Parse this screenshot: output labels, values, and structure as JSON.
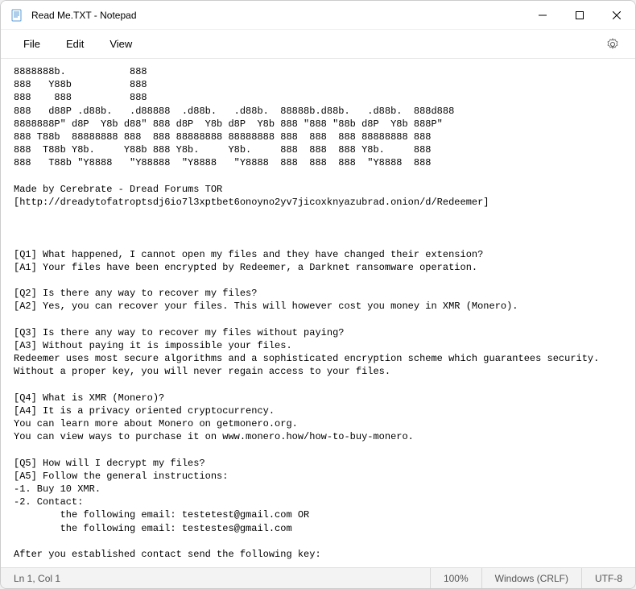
{
  "window": {
    "title": "Read Me.TXT - Notepad"
  },
  "menu": {
    "file": "File",
    "edit": "Edit",
    "view": "View"
  },
  "content": {
    "text": "8888888b.           888\n888   Y88b          888\n888    888          888\n888   d88P .d88b.   .d88888  .d88b.   .d88b.  88888b.d88b.   .d88b.  888d888\n8888888P\" d8P  Y8b d88\" 888 d8P  Y8b d8P  Y8b 888 \"888 \"88b d8P  Y8b 888P\"\n888 T88b  88888888 888  888 88888888 88888888 888  888  888 88888888 888\n888  T88b Y8b.     Y88b 888 Y8b.     Y8b.     888  888  888 Y8b.     888\n888   T88b \"Y8888   \"Y88888  \"Y8888   \"Y8888  888  888  888  \"Y8888  888\n\nMade by Cerebrate - Dread Forums TOR\n[http://dreadytofatroptsdj6io7l3xptbet6onoyno2yv7jicoxknyazubrad.onion/d/Redeemer]\n\n\n\n[Q1] What happened, I cannot open my files and they have changed their extension?\n[A1] Your files have been encrypted by Redeemer, a Darknet ransomware operation.\n\n[Q2] Is there any way to recover my files?\n[A2] Yes, you can recover your files. This will however cost you money in XMR (Monero).\n\n[Q3] Is there any way to recover my files without paying?\n[A3] Without paying it is impossible your files.\nRedeemer uses most secure algorithms and a sophisticated encryption scheme which guarantees security.\nWithout a proper key, you will never regain access to your files.\n\n[Q4] What is XMR (Monero)?\n[A4] It is a privacy oriented cryptocurrency.\nYou can learn more about Monero on getmonero.org.\nYou can view ways to purchase it on www.monero.how/how-to-buy-monero.\n\n[Q5] How will I decrypt my files?\n[A5] Follow the general instructions:\n-1. Buy 10 XMR.\n-2. Contact:\n        the following email: testetest@gmail.com OR\n        the following email: testestes@gmail.com\n\nAfter you established contact send the following key:"
  },
  "statusbar": {
    "position": "Ln 1, Col 1",
    "zoom": "100%",
    "line_ending": "Windows (CRLF)",
    "encoding": "UTF-8"
  }
}
